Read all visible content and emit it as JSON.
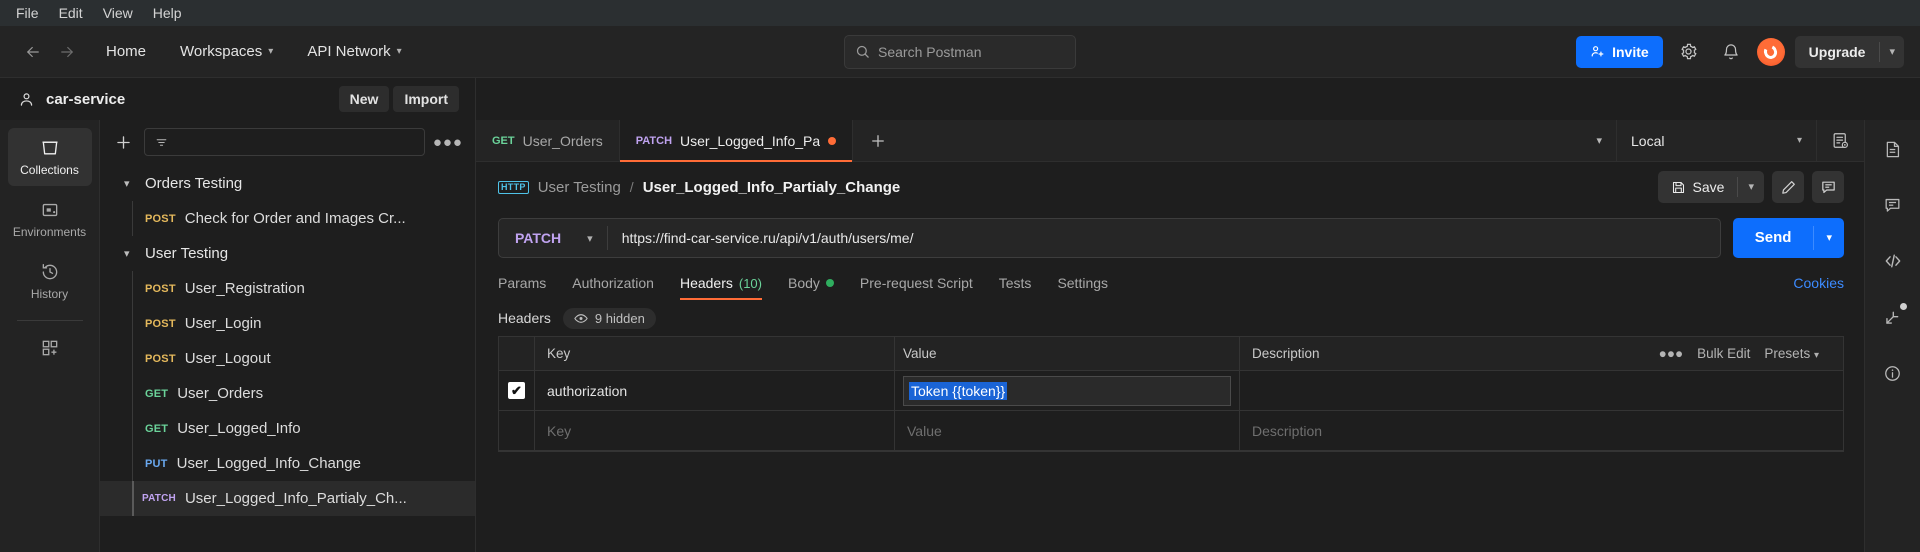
{
  "menubar": {
    "items": [
      "File",
      "Edit",
      "View",
      "Help"
    ]
  },
  "topbar": {
    "back_icon": "arrow-left-icon",
    "forward_icon": "arrow-right-icon",
    "home_label": "Home",
    "workspaces_label": "Workspaces",
    "api_network_label": "API Network",
    "search_placeholder": "Search Postman",
    "invite_label": "Invite",
    "settings_icon": "gear-icon",
    "notifications_icon": "bell-icon",
    "avatar": "user-avatar",
    "upgrade_label": "Upgrade",
    "accent_blue": "#0d6efd"
  },
  "workspace": {
    "name": "car-service",
    "new_label": "New",
    "import_label": "Import"
  },
  "rail": {
    "items": [
      {
        "label": "Collections",
        "icon": "collections-icon",
        "active": true
      },
      {
        "label": "Environments",
        "icon": "environments-icon",
        "active": false
      },
      {
        "label": "History",
        "icon": "history-icon",
        "active": false
      }
    ],
    "add_label": "",
    "add_icon": "new-module-icon"
  },
  "sidebar": {
    "filter_placeholder": "",
    "more_icon": "more-horizontal-icon",
    "tree": [
      {
        "type": "folder",
        "label": "Orders Testing",
        "expanded": true
      },
      {
        "type": "request",
        "method": "POST",
        "label": "Check for Order and Images Cr...",
        "selected": false
      },
      {
        "type": "folder",
        "label": "User Testing",
        "expanded": true
      },
      {
        "type": "request",
        "method": "POST",
        "label": "User_Registration",
        "selected": false
      },
      {
        "type": "request",
        "method": "POST",
        "label": "User_Login",
        "selected": false
      },
      {
        "type": "request",
        "method": "POST",
        "label": "User_Logout",
        "selected": false
      },
      {
        "type": "request",
        "method": "GET",
        "label": "User_Orders",
        "selected": false
      },
      {
        "type": "request",
        "method": "GET",
        "label": "User_Logged_Info",
        "selected": false
      },
      {
        "type": "request",
        "method": "PUT",
        "label": "User_Logged_Info_Change",
        "selected": false
      },
      {
        "type": "request",
        "method": "PATCH",
        "label": "User_Logged_Info_Partialy_Ch...",
        "selected": true
      }
    ]
  },
  "tabs": {
    "items": [
      {
        "method": "GET",
        "name": "User_Orders",
        "active": false,
        "unsaved": false
      },
      {
        "method": "PATCH",
        "name": "User_Logged_Info_Pa",
        "active": true,
        "unsaved": true
      }
    ],
    "new_tab_icon": "plus-icon",
    "overflow_icon": "chevron-down-icon",
    "environment": "Local",
    "env_eye_icon": "environment-quick-look-icon"
  },
  "request_header": {
    "protocol_badge": "HTTP",
    "breadcrumb_parent": "User Testing",
    "breadcrumb_separator": "/",
    "breadcrumb_current": "User_Logged_Info_Partialy_Change",
    "save_label": "Save",
    "save_icon": "floppy-disk-icon",
    "save_caret_icon": "chevron-down-icon",
    "edit_icon": "pencil-icon",
    "comment_icon": "comment-icon"
  },
  "url_bar": {
    "method": "PATCH",
    "method_caret": "chevron-down-icon",
    "url": "https://find-car-service.ru/api/v1/auth/users/me/",
    "send_label": "Send",
    "send_caret_icon": "chevron-down-icon",
    "method_color": "#c0a3f0"
  },
  "request_tabs": {
    "items": [
      {
        "label": "Params",
        "active": false,
        "badge": "",
        "dot": false
      },
      {
        "label": "Authorization",
        "active": false,
        "badge": "",
        "dot": false
      },
      {
        "label": "Headers",
        "active": true,
        "badge": "(10)",
        "dot": false
      },
      {
        "label": "Body",
        "active": false,
        "badge": "",
        "dot": true
      },
      {
        "label": "Pre-request Script",
        "active": false,
        "badge": "",
        "dot": false
      },
      {
        "label": "Tests",
        "active": false,
        "badge": "",
        "dot": false
      },
      {
        "label": "Settings",
        "active": false,
        "badge": "",
        "dot": false
      }
    ],
    "cookies_label": "Cookies",
    "active_underline_color": "#ff6c37"
  },
  "headers_section": {
    "title": "Headers",
    "hidden_pill_label": "9 hidden",
    "eye_icon": "eye-icon",
    "columns": [
      "Key",
      "Value",
      "Description"
    ],
    "actions": {
      "more_icon": "more-horizontal-icon",
      "bulk_edit_label": "Bulk Edit",
      "presets_label": "Presets",
      "presets_caret": "chevron-down-icon"
    },
    "rows": [
      {
        "checked": true,
        "key": "authorization",
        "value": "Token {{token}}",
        "value_selected": true,
        "description": ""
      }
    ],
    "empty_row": {
      "key_placeholder": "Key",
      "value_placeholder": "Value",
      "description_placeholder": "Description"
    }
  },
  "right_rail": {
    "icons": [
      "documentation-icon",
      "comment-icon",
      "code-icon",
      "runner-icon",
      "info-icon"
    ]
  }
}
